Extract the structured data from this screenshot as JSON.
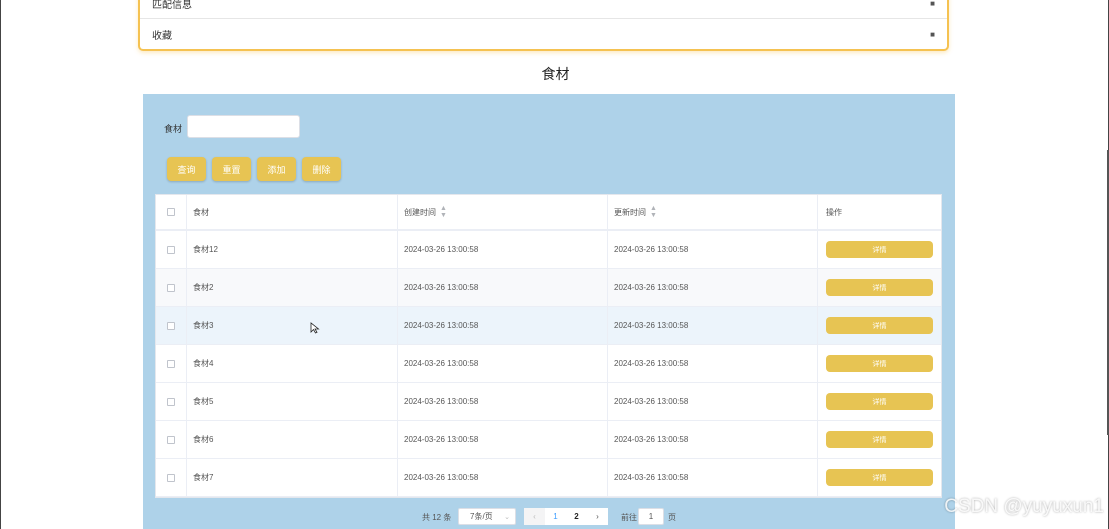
{
  "menu": {
    "items": [
      {
        "label": "匹配信息",
        "icon": "lock-icon"
      },
      {
        "label": "收藏",
        "icon": "lock-icon"
      }
    ]
  },
  "section_title": "食材",
  "search": {
    "label": "食材",
    "value": "",
    "placeholder": ""
  },
  "actions": {
    "query": "查询",
    "reset": "重置",
    "add": "添加",
    "delete": "删除"
  },
  "table": {
    "headers": {
      "name": "食材",
      "created": "创建时间",
      "updated": "更新时间",
      "ops": "操作"
    },
    "detail_label": "详情",
    "rows": [
      {
        "name": "食材12",
        "created": "2024-03-26 13:00:58",
        "updated": "2024-03-26 13:00:58"
      },
      {
        "name": "食材2",
        "created": "2024-03-26 13:00:58",
        "updated": "2024-03-26 13:00:58"
      },
      {
        "name": "食材3",
        "created": "2024-03-26 13:00:58",
        "updated": "2024-03-26 13:00:58"
      },
      {
        "name": "食材4",
        "created": "2024-03-26 13:00:58",
        "updated": "2024-03-26 13:00:58"
      },
      {
        "name": "食材5",
        "created": "2024-03-26 13:00:58",
        "updated": "2024-03-26 13:00:58"
      },
      {
        "name": "食材6",
        "created": "2024-03-26 13:00:58",
        "updated": "2024-03-26 13:00:58"
      },
      {
        "name": "食材7",
        "created": "2024-03-26 13:00:58",
        "updated": "2024-03-26 13:00:58"
      }
    ]
  },
  "pagination": {
    "total": "共 12 条",
    "page_size": "7条/页",
    "pages": [
      "1",
      "2"
    ],
    "current_page": "2",
    "goto_label": "前往",
    "goto_value": "1",
    "page_suffix": "页"
  },
  "watermark": "CSDN @yuyuxun1",
  "colors": {
    "panel_bg": "#aed2e9",
    "button": "#e7c453",
    "menu_border": "#f5c251"
  }
}
